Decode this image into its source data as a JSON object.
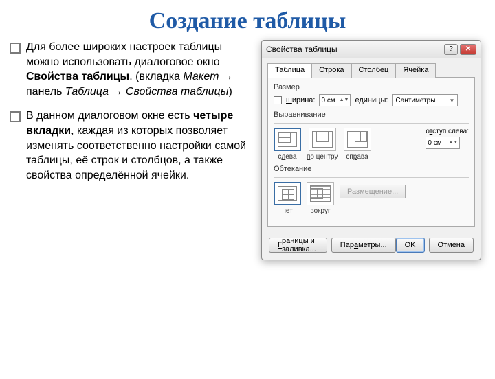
{
  "title": "Создание таблицы",
  "bullets": {
    "b1_a": "Для более широких настроек таблицы можно использовать диалоговое окно ",
    "b1_bold": "Свойства таблицы",
    "b1_b": ". (вкладка ",
    "b1_i1": "Макет",
    "b1_c": " → панель ",
    "b1_i2": "Таблица",
    "b1_d": " → ",
    "b1_i3": "Свойства таблицы",
    "b1_e": ")",
    "b2_a": " В данном диалоговом окне есть ",
    "b2_bold": "четыре вкладки",
    "b2_b": ", каждая из которых позволяет изменять соответственно настройки самой таблицы, её строк и столбцов, а также свойства определённой ячейки."
  },
  "dialog": {
    "title": "Свойства таблицы",
    "tabs": {
      "t0": "Таблица",
      "t1": "Строка",
      "t2": "Столбец",
      "t3": "Ячейка"
    },
    "size": {
      "group": "Размер",
      "width_label": "ширина:",
      "width_value": "0 см",
      "units_label": "единицы:",
      "units_value": "Сантиметры"
    },
    "align": {
      "group": "Выравнивание",
      "left": "слева",
      "center": "по центру",
      "right": "справа",
      "indent_label": "отступ слева:",
      "indent_value": "0 см"
    },
    "wrap": {
      "group": "Обтекание",
      "none": "нет",
      "around": "вокруг",
      "position_btn": "Размещение..."
    },
    "footer": {
      "borders": "Границы и заливка...",
      "params": "Параметры...",
      "ok": "OK",
      "cancel": "Отмена"
    }
  }
}
